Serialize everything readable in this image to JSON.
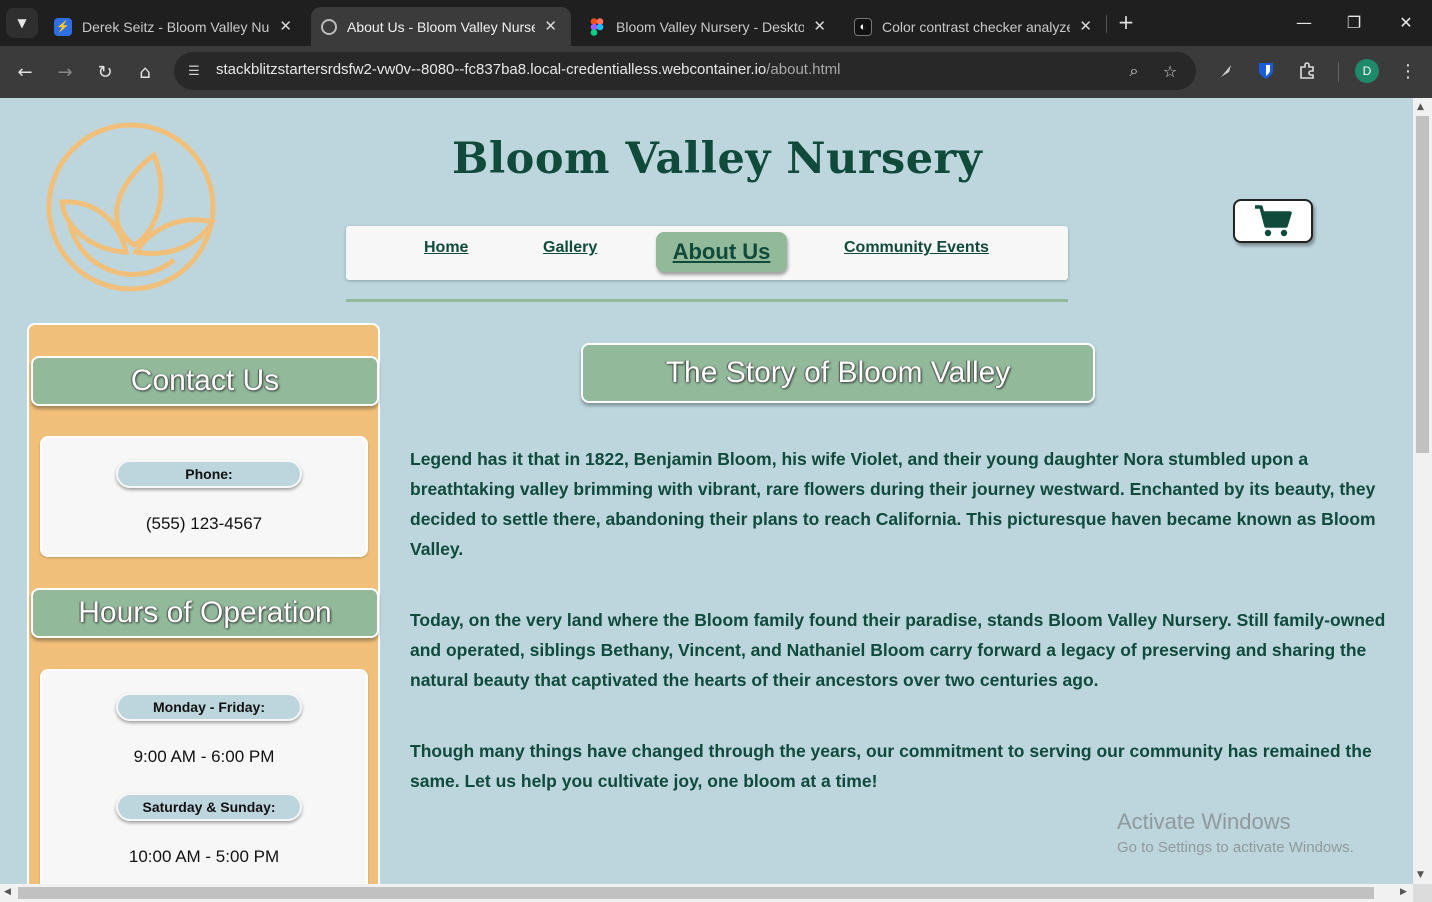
{
  "browser": {
    "tabs": [
      {
        "title": "Derek Seitz - Bloom Valley Nurs",
        "icon": "bolt-icon",
        "active": false
      },
      {
        "title": "About Us - Bloom Valley Nurser",
        "icon": "globe-icon",
        "active": true
      },
      {
        "title": "Bloom Valley Nursery - Desktop",
        "icon": "figma-icon",
        "active": false
      },
      {
        "title": "Color contrast checker analyzer",
        "icon": "contrast-icon",
        "active": false
      }
    ],
    "url_host": "stackblitzstartersrdsfw2-vw0v--8080--fc837ba8.local-credentialless.webcontainer.io",
    "url_path": "/about.html",
    "profile_initial": "D",
    "colors": {
      "chrome_dark": "#1f1f1f",
      "toolbar": "#3b3b3b",
      "omnibox": "#282828"
    }
  },
  "site": {
    "title": "Bloom Valley Nursery",
    "colors": {
      "background": "#bdd6de",
      "primary_text": "#0f4a3a",
      "sage": "#91b99a",
      "orange": "#f0c07a",
      "logo": "#f0c07a"
    },
    "nav": [
      {
        "label": "Home"
      },
      {
        "label": "Gallery"
      },
      {
        "label": "About Us"
      },
      {
        "label": "Community Events"
      }
    ],
    "active_nav": "About Us",
    "cart_icon": "shopping-cart-icon"
  },
  "sidebar": {
    "contact_heading": "Contact Us",
    "phone_label": "Phone:",
    "phone_value": "(555) 123-4567",
    "hours_heading": "Hours of Operation",
    "weekday_label": "Monday - Friday:",
    "weekday_hours": "9:00 AM - 6:00 PM",
    "weekend_label": "Saturday & Sunday:",
    "weekend_hours": "10:00 AM - 5:00 PM"
  },
  "story": {
    "heading": "The Story of Bloom Valley",
    "paragraphs": [
      "Legend has it that in 1822, Benjamin Bloom, his wife Violet, and their young daughter Nora stumbled upon a breathtaking valley brimming with vibrant, rare flowers during their journey westward. Enchanted by its beauty, they decided to settle there, abandoning their plans to reach California. This picturesque haven became known as Bloom Valley.",
      "Today, on the very land where the Bloom family found their paradise, stands Bloom Valley Nursery. Still family-owned and operated, siblings Bethany, Vincent, and Nathaniel Bloom carry forward a legacy of preserving and sharing the natural beauty that captivated the hearts of their ancestors over two centuries ago.",
      "Though many things have changed through the years, our commitment to serving our community has remained the same. Let us help you cultivate joy, one bloom at a time!"
    ]
  },
  "watermark": {
    "line1": "Activate Windows",
    "line2": "Go to Settings to activate Windows."
  }
}
